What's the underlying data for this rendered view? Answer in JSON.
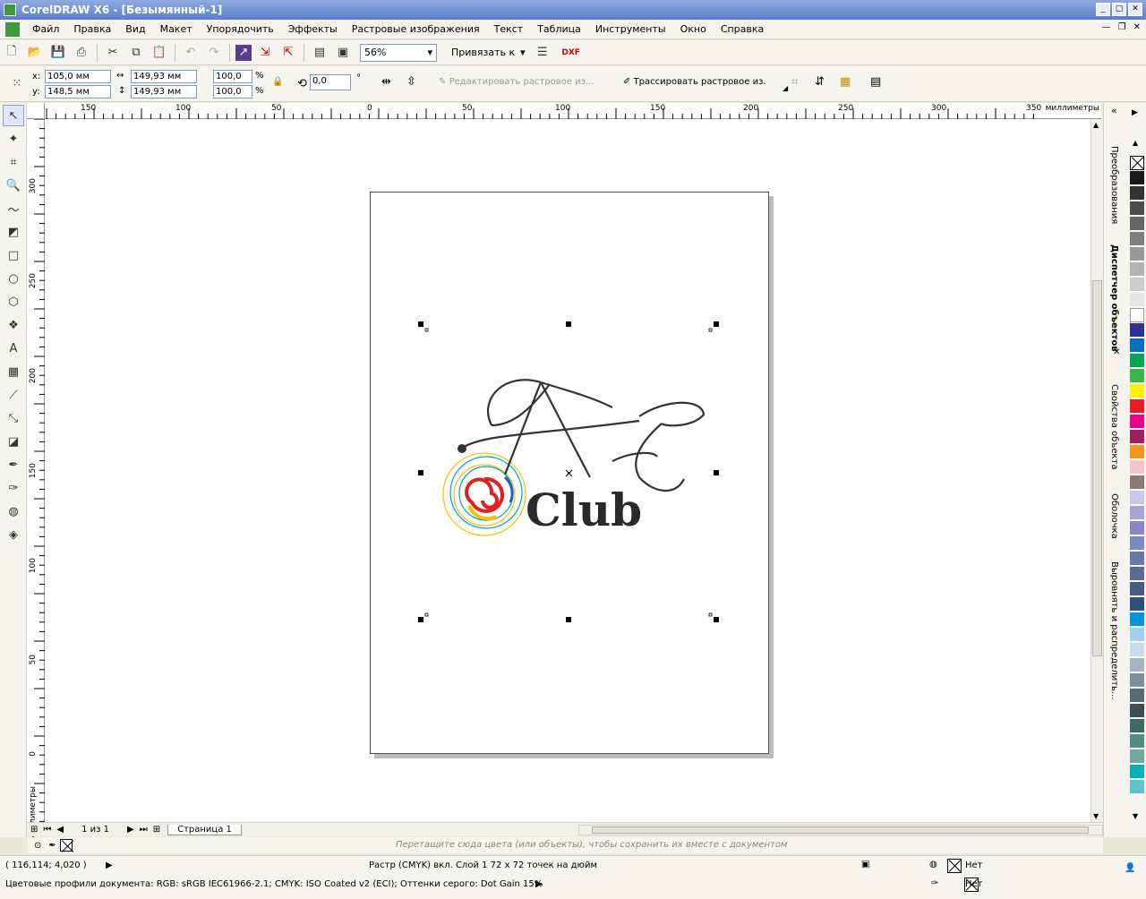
{
  "window": {
    "title": "CorelDRAW X6 - [Безымянный-1]"
  },
  "menu": [
    "Файл",
    "Правка",
    "Вид",
    "Макет",
    "Упорядочить",
    "Эффекты",
    "Растровые изображения",
    "Текст",
    "Таблица",
    "Инструменты",
    "Окно",
    "Справка"
  ],
  "toolbar": {
    "zoom": "56%",
    "snap_label": "Привязать к"
  },
  "props": {
    "x_label": "x:",
    "x": "105,0 мм",
    "y_label": "y:",
    "y": "148,5 мм",
    "w": "149,93 мм",
    "h": "149,93 мм",
    "sx": "100,0",
    "sy": "100,0",
    "pct": "%",
    "angle": "0,0",
    "deg": "°",
    "edit_bitmap": "Редактировать растровое из...",
    "trace_bitmap": "Трассировать растровое из."
  },
  "ruler": {
    "unit": "миллиметры",
    "h_ticks": [
      "150",
      "100",
      "50",
      "0",
      "50",
      "100",
      "150",
      "200",
      "250",
      "300",
      "350"
    ],
    "v_ticks": [
      "300",
      "250",
      "200",
      "150",
      "100",
      "50",
      "0"
    ]
  },
  "logo": {
    "text": "Club",
    "monogram": "AE"
  },
  "pagebar": {
    "page_of": "1 из 1",
    "page_tab": "Страница 1"
  },
  "docpalette": {
    "hint": "Перетащите сюда цвета (или объекты), чтобы сохранить их вместе с документом"
  },
  "dockers": [
    "Преобразования",
    "Диспетчер объектов",
    "Свойства объекта",
    "Оболочка",
    "Выровнять и распределить..."
  ],
  "palette_colors": [
    "#1a1a1a",
    "#333333",
    "#4d4d4d",
    "#666666",
    "#808080",
    "#999999",
    "#b3b3b3",
    "#cccccc",
    "#e6e6e6",
    "#ffffff",
    "#2e3192",
    "#0072bc",
    "#00a651",
    "#39b54a",
    "#fff200",
    "#ed1c24",
    "#ec008c",
    "#9e1f63",
    "#f7941d",
    "#f9c4c8",
    "#8c7b70",
    "#c9c6e8",
    "#a8a4d4",
    "#8987c4",
    "#7b89c4",
    "#6a77a8",
    "#5b6a94",
    "#4a5a80",
    "#2f4f7f",
    "#0095da",
    "#a0d2f0",
    "#c8dcea",
    "#a4b4c0",
    "#7f8f9a",
    "#5a6a72",
    "#3d4f55",
    "#3a6b64",
    "#4f8f87",
    "#6fa8a0",
    "#00b0b8",
    "#5fc4c9"
  ],
  "status": {
    "coords": "( 116,114; 4,020 )",
    "object_info": "Растр (CMYK) вкл. Слой 1 72 x 72 точек на дюйм",
    "profiles": "Цветовые профили документа: RGB: sRGB IEC61966-2.1; CMYK: ISO Coated v2 (ECI); Оттенки серого: Dot Gain 15%",
    "fill": "Нет",
    "outline": "Нет"
  }
}
